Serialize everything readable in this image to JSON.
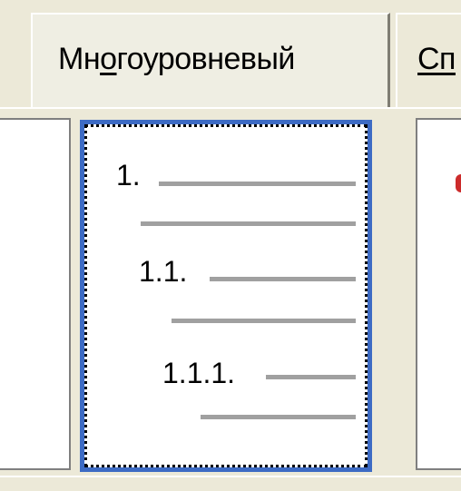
{
  "tabs": [
    {
      "label_before": "Мн",
      "label_underlined": "о",
      "label_after": "гоуровневый",
      "active": true
    },
    {
      "label_before": "",
      "label_underlined": "Сп",
      "label_after": "",
      "active": false
    }
  ],
  "list_preview": {
    "levels": [
      {
        "number": "1."
      },
      {
        "number": "1.1."
      },
      {
        "number": "1.1.1."
      }
    ]
  },
  "colors": {
    "selection_border": "#3d6bc4",
    "placeholder_line": "#a0a0a0",
    "dialog_background": "#ece9d8",
    "red_mark": "#cc2b2b"
  },
  "icons": {
    "red_mark": "red-bullet-icon"
  }
}
